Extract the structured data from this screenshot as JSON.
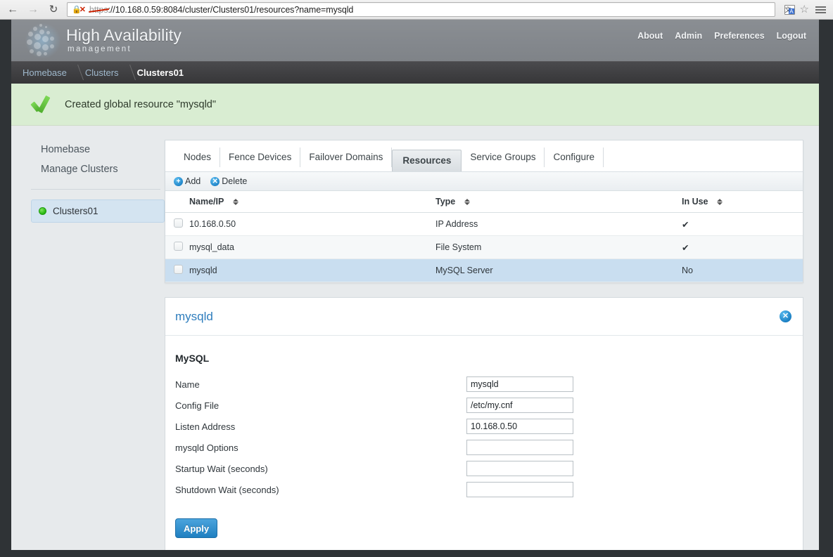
{
  "browser": {
    "back_icon": "back-arrow-icon",
    "forward_icon": "forward-arrow-icon",
    "reload_icon": "reload-icon",
    "security_icon": "broken-https-lock-icon",
    "url_scheme": "https",
    "url_rest": "://10.168.0.59:8084/cluster/Clusters01/resources?name=mysqld",
    "url_full": "https://10.168.0.59:8084/cluster/Clusters01/resources?name=mysqld",
    "translate_icon": "translate-icon",
    "bookmark_icon": "star-icon",
    "menu_icon": "hamburger-menu-icon"
  },
  "header": {
    "brand_main": "High Availability",
    "brand_sub": "management",
    "logo_icon": "dotted-cluster-logo",
    "nav": [
      {
        "label": "About"
      },
      {
        "label": "Admin"
      },
      {
        "label": "Preferences"
      },
      {
        "label": "Logout"
      }
    ]
  },
  "breadcrumb": [
    {
      "label": "Homebase",
      "active": false
    },
    {
      "label": "Clusters",
      "active": false
    },
    {
      "label": "Clusters01",
      "active": true
    }
  ],
  "banner": {
    "icon": "green-check-icon",
    "message": "Created global resource \"mysqld\"",
    "background": "#d9edd2"
  },
  "sidebar": {
    "links": [
      {
        "label": "Homebase"
      },
      {
        "label": "Manage Clusters"
      }
    ],
    "cluster": {
      "label": "Clusters01",
      "status_icon": "green-status-dot",
      "status_color": "#25b410",
      "selected_background": "#d4e4f1"
    }
  },
  "tabs": [
    {
      "label": "Nodes",
      "active": false
    },
    {
      "label": "Fence Devices",
      "active": false
    },
    {
      "label": "Failover Domains",
      "active": false
    },
    {
      "label": "Resources",
      "active": true
    },
    {
      "label": "Service Groups",
      "active": false
    },
    {
      "label": "Configure",
      "active": false
    }
  ],
  "toolbar": {
    "add_label": "Add",
    "add_icon": "plus-circle-icon",
    "delete_label": "Delete",
    "delete_icon": "x-circle-icon"
  },
  "table": {
    "columns": [
      {
        "label": "Name/IP",
        "sort_icon": "sort-arrows-icon"
      },
      {
        "label": "Type",
        "sort_icon": "sort-arrows-icon"
      },
      {
        "label": "In Use",
        "sort_icon": "sort-arrows-icon"
      }
    ],
    "rows": [
      {
        "name": "10.168.0.50",
        "type": "IP Address",
        "in_use": "✔",
        "selected": false
      },
      {
        "name": "mysql_data",
        "type": "File System",
        "in_use": "✔",
        "selected": false
      },
      {
        "name": "mysqld",
        "type": "MySQL Server",
        "in_use": "No",
        "selected": true
      }
    ]
  },
  "detail": {
    "title": "mysqld",
    "close_icon": "close-circle-icon",
    "section_title": "MySQL",
    "fields": [
      {
        "label": "Name",
        "value": "mysqld",
        "placeholder": ""
      },
      {
        "label": "Config File",
        "value": "/etc/my.cnf",
        "placeholder": ""
      },
      {
        "label": "Listen Address",
        "value": "10.168.0.50",
        "placeholder": ""
      },
      {
        "label": "mysqld Options",
        "value": "",
        "placeholder": ""
      },
      {
        "label": "Startup Wait (seconds)",
        "value": "",
        "placeholder": ""
      },
      {
        "label": "Shutdown Wait (seconds)",
        "value": "",
        "placeholder": ""
      }
    ],
    "apply_label": "Apply",
    "apply_color": "#1f7fc0"
  }
}
